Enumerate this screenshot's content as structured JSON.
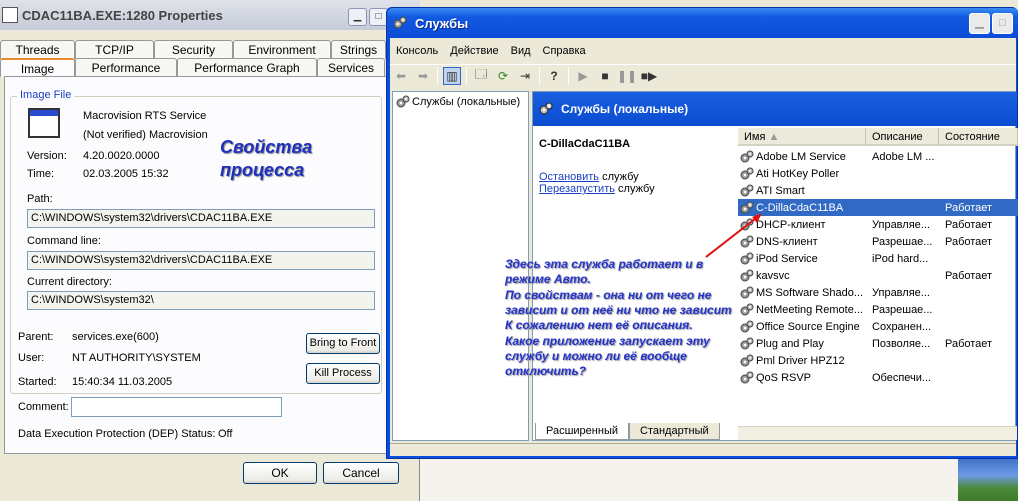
{
  "props_window": {
    "title": "CDAC11BA.EXE:1280 Properties",
    "tabs_row1": [
      "Threads",
      "TCP/IP",
      "Security",
      "Environment",
      "Strings"
    ],
    "tabs_row2": [
      "Image",
      "Performance",
      "Performance Graph",
      "Services"
    ],
    "active_tab": "Image",
    "group_label": "Image File",
    "product_name": "Macrovision RTS Service",
    "company": "(Not verified) Macrovision",
    "version_label": "Version:",
    "version_value": "4.20.0020.0000",
    "time_label": "Time:",
    "time_value": "02.03.2005 15:32",
    "path_label": "Path:",
    "path_value": "C:\\WINDOWS\\system32\\drivers\\CDAC11BA.EXE",
    "cmdline_label": "Command line:",
    "cmdline_value": "C:\\WINDOWS\\system32\\drivers\\CDAC11BA.EXE",
    "curdir_label": "Current directory:",
    "curdir_value": "C:\\WINDOWS\\system32\\",
    "parent_label": "Parent:",
    "parent_value": "services.exe(600)",
    "user_label": "User:",
    "user_value": "NT AUTHORITY\\SYSTEM",
    "started_label": "Started:",
    "started_value": "15:40:34   11.03.2005",
    "comment_label": "Comment:",
    "dep_label": "Data Execution Protection (DEP) Status:",
    "dep_value": "Off",
    "bring_to_front": "Bring to Front",
    "kill_process": "Kill Process",
    "ok": "OK",
    "cancel": "Cancel",
    "annotation_line1": "Свойства",
    "annotation_line2": "процесса"
  },
  "services_window": {
    "title": "Службы",
    "menu": [
      "Консоль",
      "Действие",
      "Вид",
      "Справка"
    ],
    "tree_item": "Службы (локальные)",
    "header_title": "Службы (локальные)",
    "selected_service": "C-DillaCdaC11BA",
    "stop_link": "Остановить",
    "stop_suffix": " службу",
    "restart_link": "Перезапустить",
    "restart_suffix": " службу",
    "columns": [
      "Имя",
      "Описание",
      "Состояние"
    ],
    "rows": [
      {
        "name": "Adobe LM Service",
        "desc": "Adobe LM ...",
        "state": ""
      },
      {
        "name": "Ati HotKey Poller",
        "desc": "",
        "state": ""
      },
      {
        "name": "ATI Smart",
        "desc": "",
        "state": ""
      },
      {
        "name": "C-DillaCdaC11BA",
        "desc": "",
        "state": "Работает"
      },
      {
        "name": "DHCP-клиент",
        "desc": "Управляе...",
        "state": "Работает"
      },
      {
        "name": "DNS-клиент",
        "desc": "Разрешае...",
        "state": "Работает"
      },
      {
        "name": "iPod Service",
        "desc": "iPod hard...",
        "state": ""
      },
      {
        "name": "kavsvc",
        "desc": "",
        "state": "Работает"
      },
      {
        "name": "MS Software Shado...",
        "desc": "Управляе...",
        "state": ""
      },
      {
        "name": "NetMeeting Remote...",
        "desc": "Разрешае...",
        "state": ""
      },
      {
        "name": "Office Source Engine",
        "desc": "Сохранен...",
        "state": ""
      },
      {
        "name": "Plug and Play",
        "desc": "Позволяе...",
        "state": "Работает"
      },
      {
        "name": "Pml Driver HPZ12",
        "desc": "",
        "state": ""
      },
      {
        "name": "QoS RSVP",
        "desc": "Обеспечи...",
        "state": ""
      }
    ],
    "tab_extended": "Расширенный",
    "tab_standard": "Стандартный",
    "annotation_lines": [
      "Здесь эта служба работает и в",
      "режиме Авто.",
      "По свойствам - она ни от чего не",
      "зависит и от неё ни что не зависит",
      "К сожалению нет её описания.",
      "Какое приложение запускает эту",
      "службу и можно ли её вообще",
      "отключить?"
    ]
  },
  "colors": {
    "xp_blue": "#0b4cd8",
    "selection": "#316ac5",
    "annotation_blue": "#2433c9",
    "arrow_red": "#e01010"
  }
}
